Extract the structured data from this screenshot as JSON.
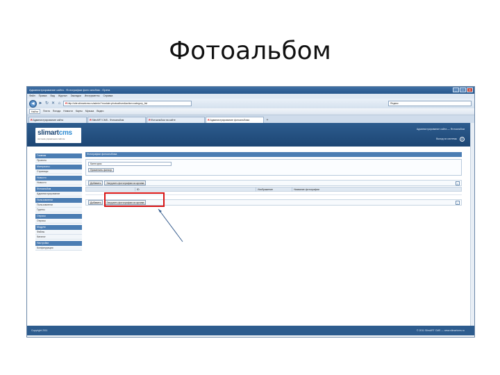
{
  "slide": {
    "title": "Фотоальбом"
  },
  "browser": {
    "window_title": "Администрирование сайта - Фотографии фото альбом - Opera",
    "menu": [
      "Файл",
      "Правка",
      "Вид",
      "Журнал",
      "Закладки",
      "Инструменты",
      "Справка"
    ],
    "back_glyph": "◄",
    "forward_glyph": "►",
    "reload_glyph": "↻",
    "stop_glyph": "✕",
    "home_glyph": "⌂",
    "url_prefix": "Я",
    "url": "http://site.slimartcms.ru/admin/?module=photoalbum&action=category_list",
    "search_text": "Яндекс",
    "toolbar_items": [
      "Найти",
      "Почта",
      "Погода",
      "Новости",
      "Карты",
      "Музыка",
      "Видео"
    ],
    "tabs": [
      {
        "label": "Администрирование сайта",
        "active": false
      },
      {
        "label": "SlimART CMS - Фотоальбом",
        "active": false
      },
      {
        "label": "Фотоальбом на сайте",
        "active": false
      },
      {
        "label": "Администрирование фотоальбома",
        "active": true
      }
    ],
    "win_buttons": [
      "_",
      "□",
      "✕"
    ]
  },
  "cms": {
    "logo_main": "slimart",
    "logo_cms": "cms",
    "logo_sub": "система управления сайтом",
    "header_line1": "Администрирование сайта — Фотоальбом",
    "header_link": "Выход из системы",
    "power_glyph": "⏻",
    "sidebar": [
      {
        "head": "Главная",
        "items": [
          "Проекты"
        ]
      },
      {
        "head": "Материалы",
        "items": [
          "Страницы"
        ]
      },
      {
        "head": "Новости",
        "items": [
          "Новости"
        ]
      },
      {
        "head": "Фотоальбом",
        "items": [
          "Администрирование"
        ]
      },
      {
        "head": "Пользователи",
        "items": [
          "Пользователи",
          "Группы"
        ]
      },
      {
        "head": "Опросы",
        "items": [
          "Опросы"
        ]
      },
      {
        "head": "Модули",
        "items": [
          "Файлы",
          "Каталог"
        ]
      },
      {
        "head": "Настройки",
        "items": [
          "Конфигурация"
        ]
      }
    ],
    "main_title": "Фотографии фотоальбома",
    "filter_select": "Категория",
    "filter_button": "Применить фильтр",
    "add_button": "Добавить",
    "upload_button": "Загрузить фотографии из архива",
    "grid_col1": "ID",
    "grid_col2": "Изображение",
    "grid_col3": "Название фотографии",
    "info_glyph": "i",
    "footer_left": "Copyright 2011",
    "footer_right": "© 2011 SlimART CMS — www.slimartcms.ru"
  },
  "colors": {
    "header_bg": "#2d5c8e",
    "section_head": "#4b7db3",
    "highlight": "#d81414",
    "arrow": "#3a5f8f"
  }
}
